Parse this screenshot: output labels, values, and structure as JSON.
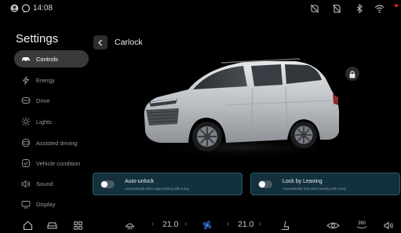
{
  "status_bar": {
    "time": "14:08",
    "left_icons": [
      "avatar-icon",
      "message-icon"
    ],
    "right_icons": [
      "no-signal-icon",
      "no-sim-icon",
      "bluetooth-icon",
      "wifi-icon"
    ],
    "notification_dot_color": "#e02020"
  },
  "sidebar": {
    "title": "Settings",
    "items": [
      {
        "label": "Controls",
        "icon": "car-icon",
        "active": true
      },
      {
        "label": "Energy",
        "icon": "lightning-icon",
        "active": false
      },
      {
        "label": "Drive",
        "icon": "steering-icon",
        "active": false
      },
      {
        "label": "Lights",
        "icon": "sun-icon",
        "active": false
      },
      {
        "label": "Assisted driving",
        "icon": "assist-icon",
        "active": false
      },
      {
        "label": "Vehicle condition",
        "icon": "condition-icon",
        "active": false
      },
      {
        "label": "Sound",
        "icon": "speaker-icon",
        "active": false
      },
      {
        "label": "Display",
        "icon": "display-icon",
        "active": false
      }
    ]
  },
  "header": {
    "title": "Carlock"
  },
  "cards": [
    {
      "title": "Auto-unlock",
      "subtitle": "Automatically when approaching with a key",
      "enabled": false
    },
    {
      "title": "Lock by Leaving",
      "subtitle": "Automatically lock when leaving with a key",
      "enabled": false
    }
  ],
  "dock": {
    "left_temp": "21.0",
    "right_temp": "21.0",
    "view_label": "360",
    "accent_color": "#3a7ff0"
  },
  "colors": {
    "card_bg": "#13303d",
    "card_border": "#2a5a6e",
    "active_item_bg": "#3a3a3a"
  }
}
